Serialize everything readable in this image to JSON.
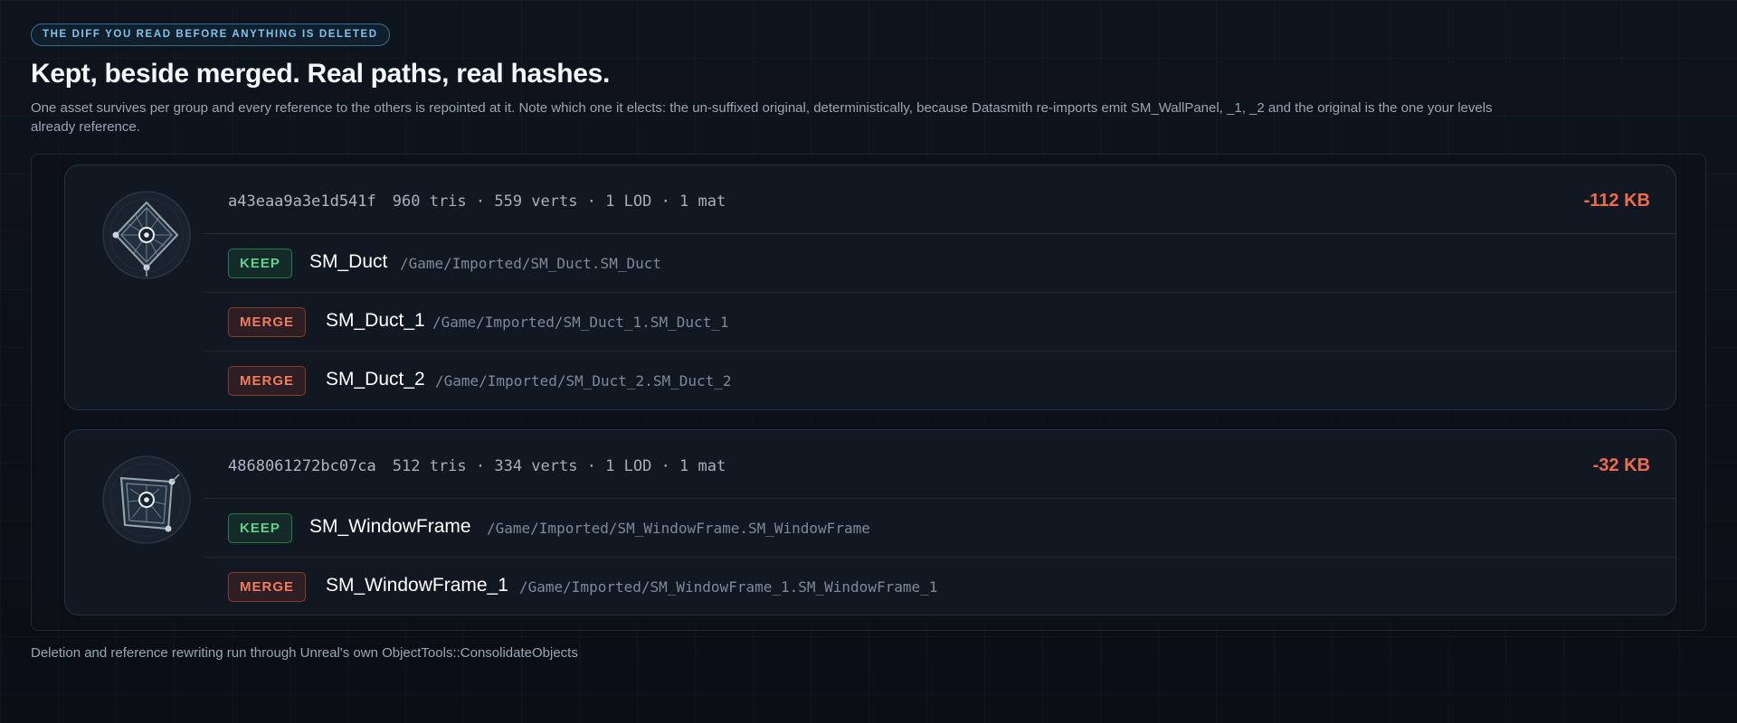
{
  "header": {
    "eyebrow": "THE DIFF YOU READ BEFORE ANYTHING IS DELETED",
    "title": "Kept, beside merged. Real paths, real hashes.",
    "lede": "One asset survives per group and every reference to the others is repointed at it. Note which one it elects: the un-suffixed original, deterministically, because Datasmith re-imports emit SM_WallPanel, _1, _2 and the original is the one your levels already reference."
  },
  "groups": [
    {
      "hash": "a43eaa9a3e1d541f",
      "stats": "960 tris · 559 verts · 1 LOD · 1 mat",
      "saving": "-112 KB",
      "thumb_icon": "mesh-diamond-icon",
      "rows": [
        {
          "badge": "KEEP",
          "name": "SM_Duct",
          "path": "/Game/Imported/SM_Duct.SM_Duct"
        },
        {
          "badge": "MERGE",
          "name": "SM_Duct_1",
          "path": "/Game/Imported/SM_Duct_1.SM_Duct_1"
        },
        {
          "badge": "MERGE",
          "name": "SM_Duct_2",
          "path": "/Game/Imported/SM_Duct_2.SM_Duct_2"
        }
      ]
    },
    {
      "hash": "4868061272bc07ca",
      "stats": "512 tris · 334 verts · 1 LOD · 1 mat",
      "saving": "-32 KB",
      "thumb_icon": "mesh-frame-icon",
      "rows": [
        {
          "badge": "KEEP",
          "name": "SM_WindowFrame",
          "path": "/Game/Imported/SM_WindowFrame.SM_WindowFrame"
        },
        {
          "badge": "MERGE",
          "name": "SM_WindowFrame_1",
          "path": "/Game/Imported/SM_WindowFrame_1.SM_WindowFrame_1"
        }
      ]
    }
  ],
  "footer": {
    "note": "Deletion and reference rewriting run through Unreal's own ObjectTools::ConsolidateObjects"
  },
  "colors": {
    "keep": "#5fd38a",
    "merge": "#f07c5e",
    "saving": "#f06b4e",
    "accent": "#7ec4ee"
  }
}
